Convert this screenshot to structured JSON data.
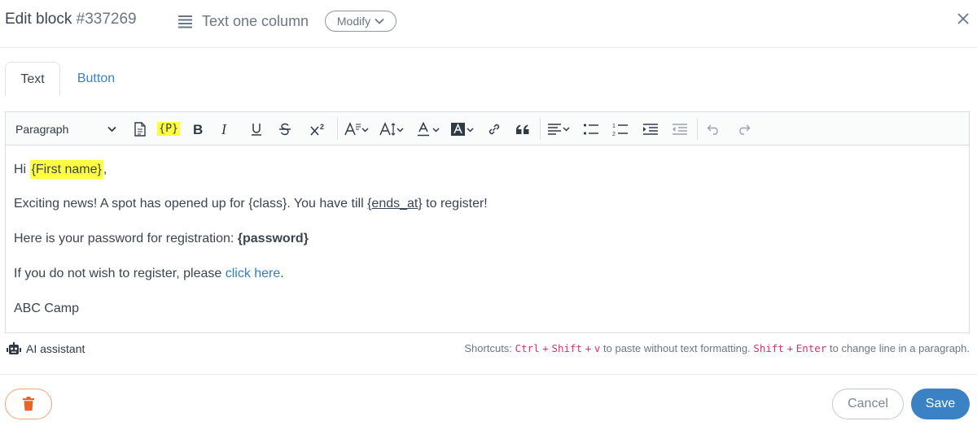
{
  "header": {
    "title": "Edit block",
    "block_id": "#337269",
    "block_type": "Text one column",
    "modify_label": "Modify"
  },
  "tabs": [
    {
      "label": "Text",
      "active": true
    },
    {
      "label": "Button",
      "active": false
    }
  ],
  "toolbar": {
    "paragraph_select": "Paragraph",
    "placeholder_tag": "{P}",
    "icons": [
      "document-icon",
      "placeholder-icon",
      "bold-icon",
      "italic-icon",
      "underline-icon",
      "strikethrough-icon",
      "superscript-icon",
      "font-family-icon",
      "font-size-icon",
      "font-color-icon",
      "highlight-color-icon",
      "link-icon",
      "blockquote-icon",
      "align-icon",
      "bullet-list-icon",
      "numbered-list-icon",
      "indent-icon",
      "outdent-icon",
      "undo-icon",
      "redo-icon"
    ]
  },
  "content": {
    "line1_prefix": "Hi ",
    "line1_var": "{First name}",
    "line1_suffix": ",",
    "line2_prefix": "Exciting news! A spot has opened up for {class}. You have till ",
    "line2_var": "{ends_at}",
    "line2_suffix": " to register!",
    "line3_prefix": "Here is your password for registration: ",
    "line3_bold": "{password}",
    "line4_prefix": "If you do not wish to register, please ",
    "line4_link": "click here",
    "line4_suffix": ".",
    "line5": "ABC Camp"
  },
  "footer": {
    "ai_label": "AI assistant",
    "shortcuts_label": "Shortcuts:",
    "key_ctrl": "Ctrl",
    "key_shift": "Shift",
    "key_v": "v",
    "key_enter": "Enter",
    "plus": "+",
    "paste_text": "to paste without text formatting.",
    "newline_text": "to change line in a paragraph."
  },
  "actions": {
    "cancel_label": "Cancel",
    "save_label": "Save"
  },
  "colors": {
    "primary": "#3a82c4",
    "link": "#2f7fc4",
    "highlight": "#ffff3d",
    "delete": "#e8622c",
    "kbd": "#d6336c"
  }
}
